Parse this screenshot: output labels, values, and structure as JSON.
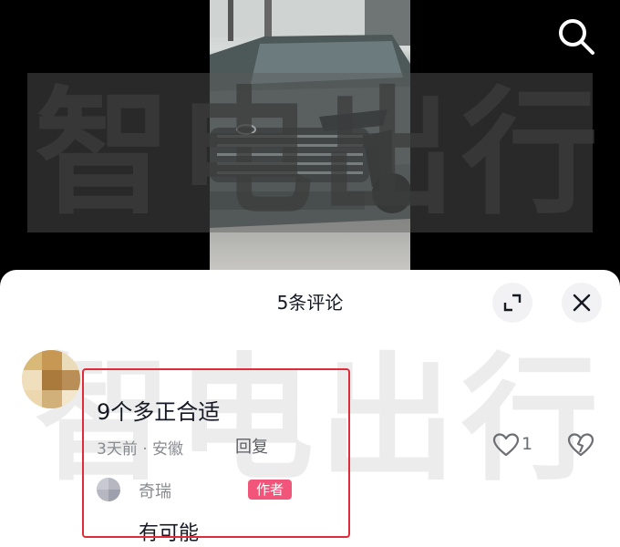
{
  "video": {
    "watermark": "智电出行"
  },
  "comments_panel": {
    "title": "5条评论",
    "watermark": "智电出行",
    "comment": {
      "text": "9个多正合适",
      "time_location": "3天前 · 安徽",
      "reply_label": "回复",
      "like_count": "1",
      "reply": {
        "user": "奇瑞",
        "badge": "作者",
        "text": "有可能"
      }
    }
  },
  "colors": {
    "author_badge": "#f2557a",
    "highlight_border": "#e02b3a"
  },
  "icons": [
    "search-icon",
    "expand-icon",
    "close-icon",
    "heart-icon",
    "broken-heart-icon"
  ]
}
